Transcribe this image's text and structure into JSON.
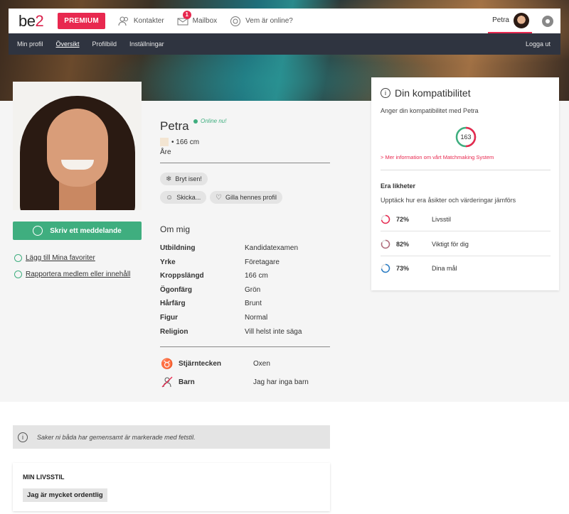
{
  "header": {
    "logo_text": "be",
    "logo_num": "2",
    "premium": "PREMIUM",
    "nav": [
      {
        "label": "Kontakter",
        "icon": "contacts-icon"
      },
      {
        "label": "Mailbox",
        "icon": "mail-icon",
        "badge": "1"
      },
      {
        "label": "Vem är online?",
        "icon": "online-icon"
      }
    ],
    "user_name": "Petra"
  },
  "subnav": {
    "items": [
      "Min profil",
      "Översikt",
      "Profilbild",
      "Inställningar"
    ],
    "active": "Översikt",
    "logout": "Logga ut"
  },
  "profile": {
    "name": "Petra",
    "online": "Online nu!",
    "height": "• 166 cm",
    "city": "Åre",
    "actions": {
      "icebreak": "Bryt isen!",
      "send": "Skicka...",
      "like": "Gilla hennes profil"
    },
    "message_button": "Skriv ett meddelande",
    "favorites_link": "Lägg till Mina favoriter",
    "report_link": "Rapportera medlem eller innehåll"
  },
  "about": {
    "title": "Om mig",
    "rows": [
      {
        "k": "Utbildning",
        "v": "Kandidatexamen"
      },
      {
        "k": "Yrke",
        "v": "Företagare"
      },
      {
        "k": "Kroppslängd",
        "v": "166 cm"
      },
      {
        "k": "Ögonfärg",
        "v": "Grön"
      },
      {
        "k": "Hårfärg",
        "v": "Brunt"
      },
      {
        "k": "Figur",
        "v": "Normal"
      },
      {
        "k": "Religion",
        "v": "Vill helst inte säga"
      }
    ],
    "sign_label": "Stjärntecken",
    "sign_value": "Oxen",
    "kids_label": "Barn",
    "kids_value": "Jag har inga barn"
  },
  "compat": {
    "title": "Din kompatibilitet",
    "subtitle": "Anger din kompatibilitet med Petra",
    "score": "163",
    "more": "> Mer information om vårt Matchmaking System",
    "similar_title": "Era likheter",
    "similar_sub": "Upptäck hur era åsikter och värderingar jämförs",
    "rows": [
      {
        "pct": "72%",
        "label": "Livsstil",
        "fraction": 0.72,
        "color": "#e8284f"
      },
      {
        "pct": "82%",
        "label": "Viktigt för dig",
        "fraction": 0.82,
        "color": "#b06a7a"
      },
      {
        "pct": "73%",
        "label": "Dina mål",
        "fraction": 0.73,
        "color": "#2a7cc4"
      }
    ]
  },
  "notice": "Saker ni båda har gemensamt är markerade med fetstil.",
  "lifestyle": {
    "title": "MIN LIVSSTIL",
    "tag": "Jag är mycket ordentlig"
  }
}
